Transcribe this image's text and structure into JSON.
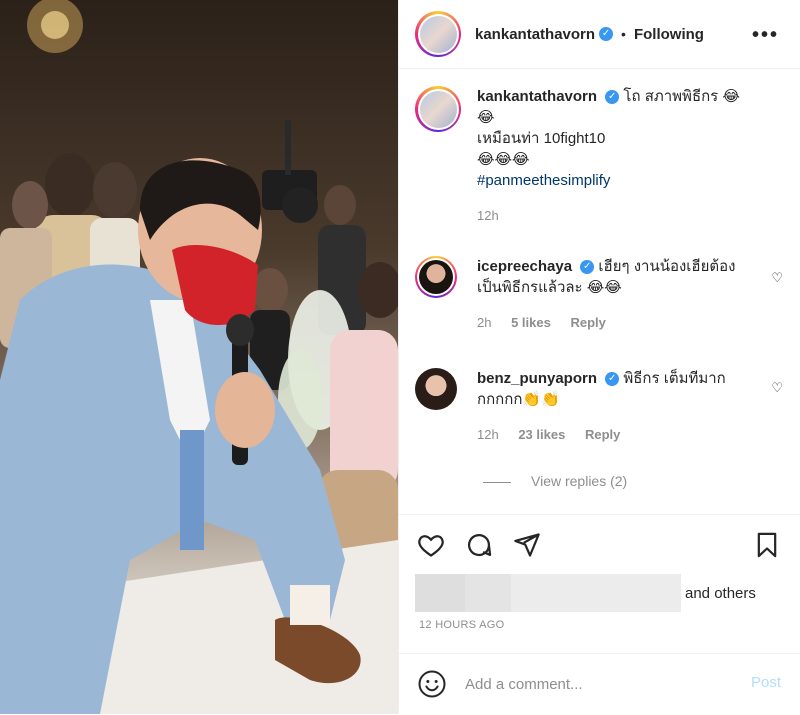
{
  "post": {
    "author": "kankantathavorn",
    "follow_status": "Following",
    "separator": "•",
    "more_label": "•••"
  },
  "caption": {
    "username": "kankantathavorn",
    "line1": "โถ สภาพพิธีกร 😂",
    "line2": "😂",
    "line3": "เหมือนท่า 10fight10",
    "line4": "😂😂😂",
    "hashtag": "#panmeethesimplify",
    "time": "12h"
  },
  "comments": [
    {
      "username": "icepreechaya",
      "text_line1": "เฮียๆ งานน้องเฮียต้อง",
      "text_line2": "เป็นพิธีกรแล้วละ 😂😂",
      "time": "2h",
      "likes": "5 likes",
      "reply": "Reply"
    },
    {
      "username": "benz_punyaporn",
      "text_line1": "พิธีกร เต็มทีมาก",
      "text_line2": "กกกกก👏👏",
      "time": "12h",
      "likes": "23 likes",
      "reply": "Reply"
    }
  ],
  "view_replies": "View replies (2)",
  "likes_suffix": "and others",
  "timestamp": "12 HOURS AGO",
  "add_comment": {
    "placeholder": "Add a comment...",
    "post_label": "Post"
  },
  "icons": {
    "like": "heart-icon",
    "comment": "comment-icon",
    "share": "paper-plane-icon",
    "save": "bookmark-icon",
    "emoji": "smiley-icon",
    "more": "more-dots-icon",
    "verified": "verified-badge-icon"
  },
  "colors": {
    "verified": "#3897f0",
    "hashtag": "#00376b",
    "muted": "#8e8e8e",
    "post_disabled": "#b2dffc"
  }
}
